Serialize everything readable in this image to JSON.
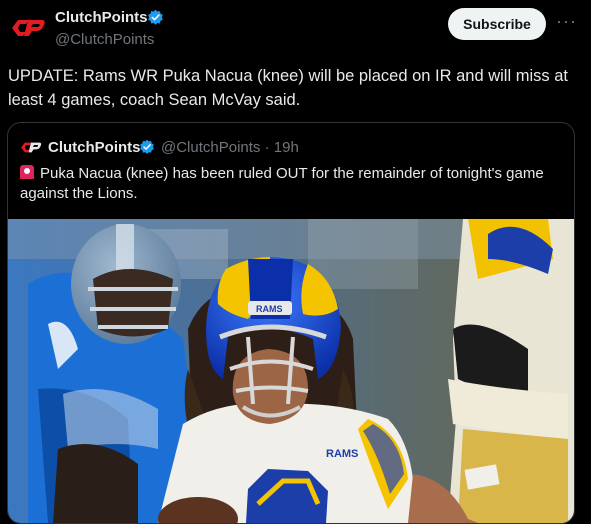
{
  "author": {
    "name": "ClutchPoints",
    "handle": "@ClutchPoints",
    "verified": true
  },
  "actions": {
    "subscribe_label": "Subscribe",
    "more_icon": "more-horizontal-icon"
  },
  "tweet": {
    "text": "UPDATE: Rams WR Puka Nacua (knee) will be placed on IR and will miss at least 4 games, coach Sean McVay said."
  },
  "quoted": {
    "name": "ClutchPoints",
    "handle": "@ClutchPoints",
    "separator": "·",
    "time": "19h",
    "text": "Puka Nacua (knee) has been ruled OUT for the remainder of tonight's game against the Lions.",
    "emoji": "siren-icon"
  },
  "photo_text": {
    "helmet_logo": "RAMS",
    "chest_logo": "RAMS"
  },
  "colors": {
    "background": "#000000",
    "text": "#e7e9ea",
    "muted": "#71767b",
    "verified": "#1d9bf0",
    "brand_red": "#e31b23"
  }
}
